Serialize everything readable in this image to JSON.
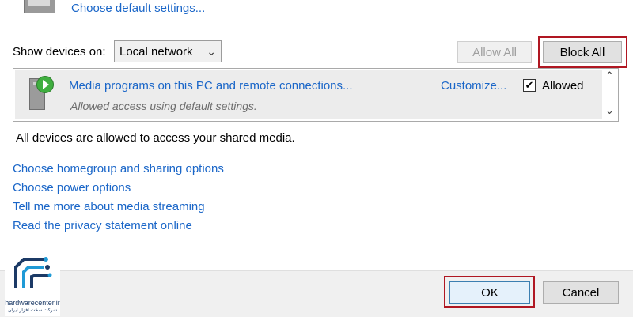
{
  "top": {
    "link": "Choose default settings..."
  },
  "devices": {
    "label": "Show devices on:",
    "select_value": "Local network",
    "allow_all": "Allow All",
    "block_all": "Block All"
  },
  "media_row": {
    "title": "Media programs on this PC and remote connections...",
    "subtitle": "Allowed access using default settings.",
    "customize": "Customize...",
    "allowed_checked": true,
    "allowed_label": "Allowed"
  },
  "info_text": "All devices are allowed to access your shared media.",
  "links": [
    "Choose homegroup and sharing options",
    "Choose power options",
    "Tell me more about media streaming",
    "Read the privacy statement online"
  ],
  "buttons": {
    "ok": "OK",
    "cancel": "Cancel"
  },
  "watermark": {
    "brand": "hardwarecenter.ir",
    "tagline": "شرکت سخت افزار ایران"
  },
  "colors": {
    "link": "#1a66c8",
    "highlight": "#b01722"
  }
}
